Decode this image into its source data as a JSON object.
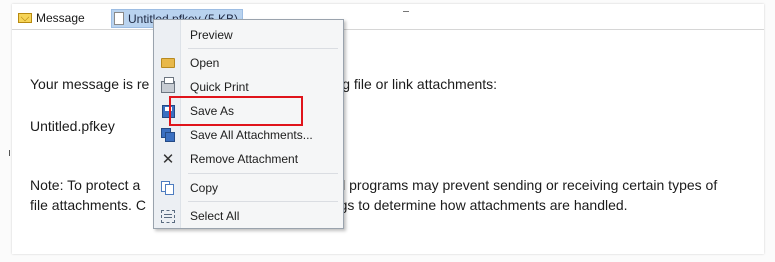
{
  "attachment_bar": {
    "message_tab_label": "Message",
    "attachment_tab_label": "Untitled.pfkey (5 KB)"
  },
  "message_body": {
    "notice_text": "Your message is re",
    "notice_text_tail": "ving file or link attachments:",
    "attachment_filename": "Untitled.pfkey",
    "note_line1_head": "Note: To protect a",
    "note_line1_tail": "ail programs may prevent sending or receiving certain types of",
    "note_line2_head": "file attachments.  C",
    "note_line2_tail": "ttings to determine how attachments are handled."
  },
  "context_menu": {
    "items": [
      {
        "label": "Preview",
        "icon": "none"
      },
      {
        "label": "Open",
        "icon": "open-folder-icon"
      },
      {
        "label": "Quick Print",
        "icon": "printer-icon"
      },
      {
        "label": "Save As",
        "icon": "save-icon"
      },
      {
        "label": "Save All Attachments...",
        "icon": "save-all-icon"
      },
      {
        "label": "Remove Attachment",
        "icon": "remove-x-icon"
      },
      {
        "label": "Copy",
        "icon": "copy-icon"
      },
      {
        "label": "Select All",
        "icon": "select-all-icon"
      }
    ]
  },
  "annotation": {
    "highlight_target": "Save As",
    "highlight_color": "#e0141b"
  },
  "colors": {
    "attachment_tab_bg": "#b9d3ef",
    "menu_bg": "#f5f6f7"
  }
}
